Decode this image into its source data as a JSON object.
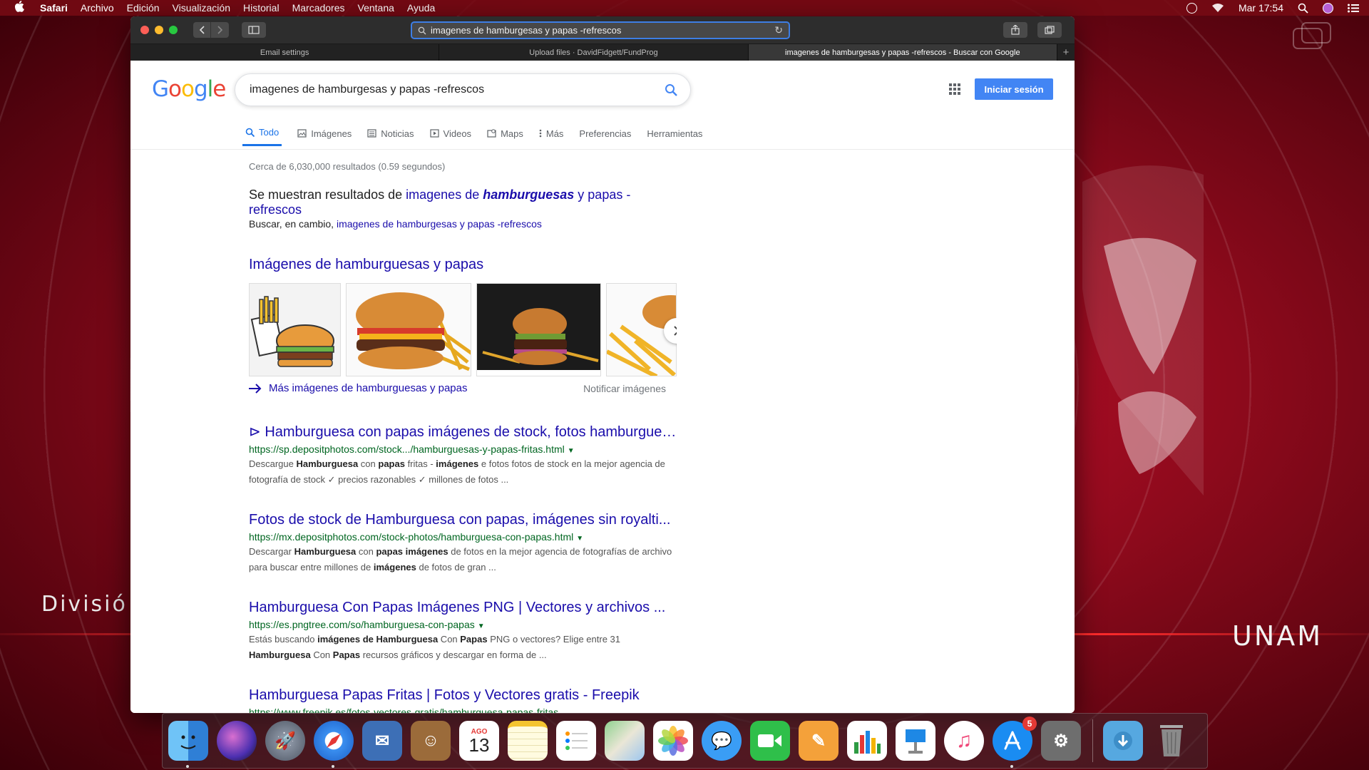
{
  "menubar": {
    "app": "Safari",
    "items": [
      "Archivo",
      "Edición",
      "Visualización",
      "Historial",
      "Marcadores",
      "Ventana",
      "Ayuda"
    ],
    "clock": "Mar 17:54"
  },
  "desktop": {
    "left_text": "Divisió",
    "right_text": "UNAM"
  },
  "safari": {
    "url": "imagenes de hamburgesas y papas -refrescos",
    "tabs": [
      {
        "label": "Email settings",
        "active": false
      },
      {
        "label": "Upload files · DavidFidgett/FundProg",
        "active": false
      },
      {
        "label": "imagenes de hamburgesas y papas -refrescos - Buscar con Google",
        "active": true
      }
    ]
  },
  "google": {
    "logo": "Google",
    "query": "imagenes de hamburgesas y papas -refrescos",
    "signin": "Iniciar sesión",
    "tabs": [
      "Todo",
      "Imágenes",
      "Noticias",
      "Videos",
      "Maps",
      "Más",
      "Preferencias",
      "Herramientas"
    ],
    "stats": "Cerca de 6,030,000 resultados (0.59 segundos)",
    "showing_prefix": "Se muestran resultados de",
    "showing_link_a": "imagenes de",
    "showing_link_b": "hamburguesas",
    "showing_link_c": "y papas -refrescos",
    "instead_prefix": "Buscar, en cambio,",
    "instead_link": "imagenes de hamburgesas y papas -refrescos",
    "images_title": "Imágenes de hamburguesas y papas",
    "more_images": "Más imágenes de hamburguesas y papas",
    "report_images": "Notificar imágenes",
    "results": [
      {
        "title": "⊳ Hamburguesa con papas imágenes de stock, fotos hamburguesa ...",
        "url": "https://sp.depositphotos.com/stock.../hamburguesas-y-papas-fritas.html",
        "snippet_html": "Descargue <b>Hamburguesa</b> con <b>papas</b> fritas - <b>imágenes</b> e fotos fotos de stock en la mejor agencia de fotografía de stock ✓ precios razonables ✓ millones de fotos ..."
      },
      {
        "title": "Fotos de stock de Hamburguesa con papas, imágenes sin royalti...",
        "url": "https://mx.depositphotos.com/stock-photos/hamburguesa-con-papas.html",
        "snippet_html": "Descargar <b>Hamburguesa</b> con <b>papas imágenes</b> de fotos en la mejor agencia de fotografías de archivo para buscar entre millones de <b>imágenes</b> de fotos de gran ..."
      },
      {
        "title": "Hamburguesa Con Papas Imágenes PNG | Vectores y archivos ...",
        "url": "https://es.pngtree.com/so/hamburguesa-con-papas",
        "snippet_html": "Estás buscando <b>imágenes de Hamburguesa</b> Con <b>Papas</b> PNG o vectores? Elige entre 31 <b>Hamburguesa</b> Con <b>Papas</b> recursos gráficos y descargar en forma de ..."
      },
      {
        "title": "Hamburguesa Papas Fritas | Fotos y Vectores gratis - Freepik",
        "url": "https://www.freepik.es/fotos-vectores-gratis/hamburguesa-papas-fritas",
        "snippet_html": ""
      }
    ]
  },
  "dock": {
    "calendar_month": "AGO",
    "calendar_day": "13",
    "appstore_badge": "5",
    "apps": [
      "finder",
      "siri",
      "launchpad",
      "safari",
      "mail",
      "contacts",
      "calendar",
      "notes",
      "reminders",
      "maps",
      "photos",
      "messages",
      "facetime",
      "pages",
      "numbers",
      "keynote",
      "itunes",
      "app-store",
      "system-preferences",
      "downloads",
      "trash"
    ]
  },
  "colors": {
    "google_blue": "#4285f4",
    "link": "#1a0dab",
    "url_green": "#006621",
    "desktop_red": "#c8102e"
  }
}
